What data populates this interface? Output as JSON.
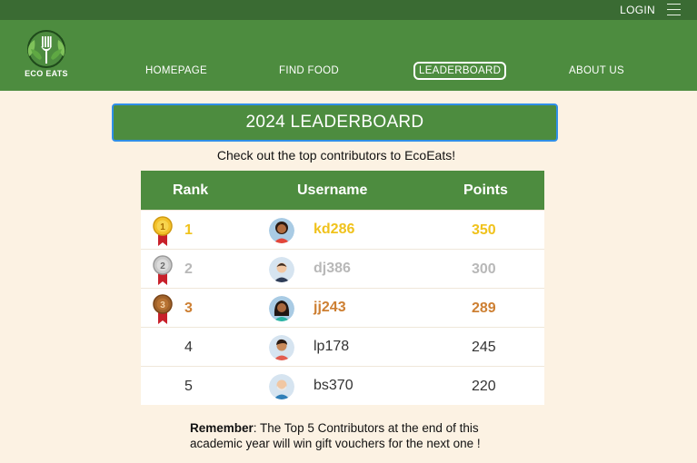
{
  "header": {
    "login_label": "LOGIN",
    "menu_icon": "hamburger-menu-icon",
    "logo_text": "ECO EATS",
    "nav": [
      {
        "label": "HOMEPAGE",
        "active": false
      },
      {
        "label": "FIND FOOD",
        "active": false
      },
      {
        "label": "LEADERBOARD",
        "active": true
      },
      {
        "label": "ABOUT US",
        "active": false
      }
    ]
  },
  "main": {
    "title": "2024 LEADERBOARD",
    "subtitle": "Check out the top contributors to EcoEats!",
    "table": {
      "headers": [
        "Rank",
        "Username",
        "Points"
      ],
      "rows": [
        {
          "rank": "1",
          "username": "kd286",
          "points": "350",
          "medal": "gold-medal-icon"
        },
        {
          "rank": "2",
          "username": "dj386",
          "points": "300",
          "medal": "silver-medal-icon"
        },
        {
          "rank": "3",
          "username": "jj243",
          "points": "289",
          "medal": "bronze-medal-icon"
        },
        {
          "rank": "4",
          "username": "lp178",
          "points": "245"
        },
        {
          "rank": "5",
          "username": "bs370",
          "points": "220"
        }
      ]
    },
    "remember_label": "Remember",
    "remember_text": ": The Top 5 Contributors at the end of this academic year will win gift vouchers for the next one !"
  },
  "colors": {
    "nav_green": "#4d8c3f",
    "top_green": "#3a6b33",
    "background": "#fcf2e3",
    "gold": "#f0c21c",
    "silver": "#b8b8b8",
    "bronze": "#cd7f32",
    "banner_border": "#2f8fe8"
  }
}
